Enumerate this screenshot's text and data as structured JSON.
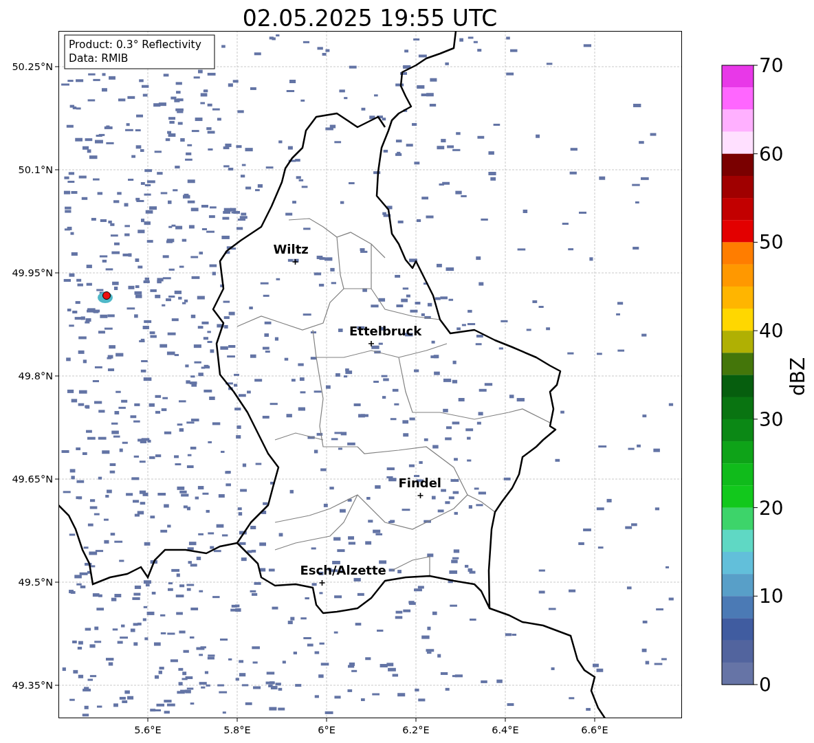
{
  "title": "02.05.2025 19:55 UTC",
  "info_box": [
    "Product: 0.3° Reflectivity",
    "Data: RMIB"
  ],
  "map": {
    "lat_ticks": [
      "50.25°N",
      "50.1°N",
      "49.95°N",
      "49.8°N",
      "49.65°N",
      "49.5°N",
      "49.35°N"
    ],
    "lon_ticks": [
      "5.6°E",
      "5.8°E",
      "6°E",
      "6.2°E",
      "6.4°E",
      "6.6°E"
    ],
    "cities": [
      "Wiltz",
      "Ettelbruck",
      "Findel",
      "Esch/Alzette"
    ]
  },
  "colorbar": {
    "label": "dBZ",
    "ticks": [
      "70",
      "60",
      "50",
      "40",
      "30",
      "20",
      "10",
      "0"
    ],
    "bins": [
      {
        "color": "#e838e8"
      },
      {
        "color": "#ff66ff"
      },
      {
        "color": "#ffb0ff"
      },
      {
        "color": "#ffe0ff"
      },
      {
        "color": "#7a0000"
      },
      {
        "color": "#a00000"
      },
      {
        "color": "#c20000"
      },
      {
        "color": "#e30000"
      },
      {
        "color": "#ff7d00"
      },
      {
        "color": "#ff9800"
      },
      {
        "color": "#ffb500"
      },
      {
        "color": "#ffd700"
      },
      {
        "color": "#b0b003"
      },
      {
        "color": "#44760a"
      },
      {
        "color": "#065e0e"
      },
      {
        "color": "#097411"
      },
      {
        "color": "#0b8815"
      },
      {
        "color": "#0ea318"
      },
      {
        "color": "#10bb1b"
      },
      {
        "color": "#12c81c"
      },
      {
        "color": "#3dd46a"
      },
      {
        "color": "#5fd8c4"
      },
      {
        "color": "#62bfda"
      },
      {
        "color": "#589fc8"
      },
      {
        "color": "#4b7ab5"
      },
      {
        "color": "#405ca0"
      },
      {
        "color": "#52649e"
      },
      {
        "color": "#6674a6"
      }
    ]
  }
}
